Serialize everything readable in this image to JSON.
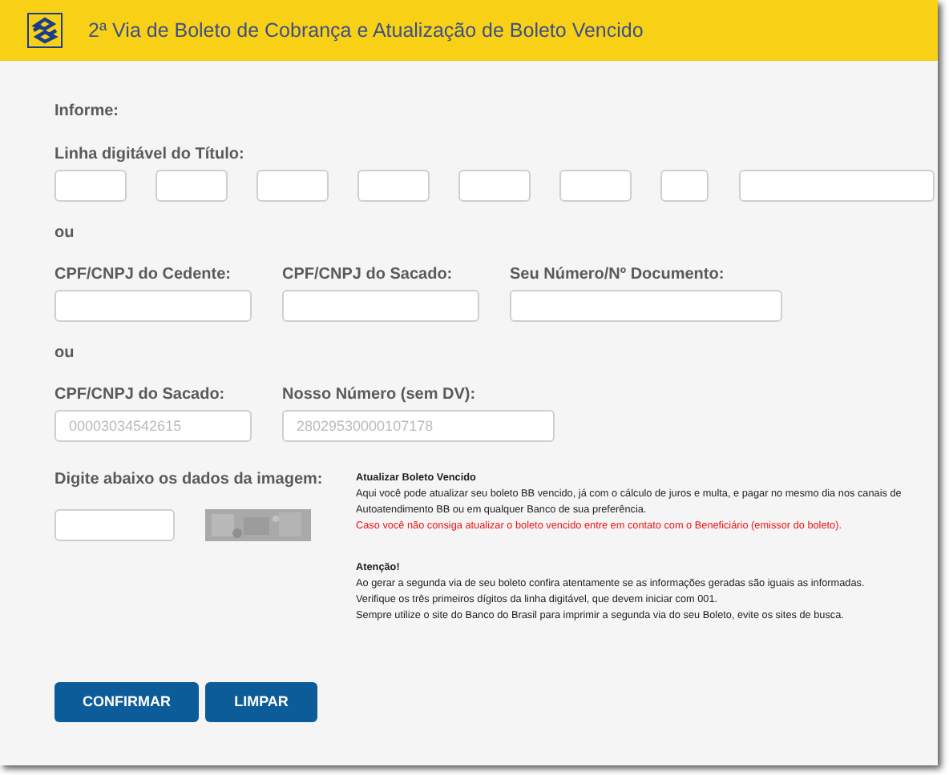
{
  "header": {
    "title": "2ª Via de Boleto de Cobrança e Atualização de Boleto Vencido"
  },
  "intro": "Informe:",
  "linha": {
    "label": "Linha digitável do Título:",
    "fields": [
      {
        "kind": "short"
      },
      {
        "kind": "short"
      },
      {
        "kind": "short"
      },
      {
        "kind": "short"
      },
      {
        "kind": "short"
      },
      {
        "kind": "short"
      },
      {
        "kind": "tiny"
      },
      {
        "kind": "long"
      }
    ]
  },
  "groups": [
    {
      "separator": "ou",
      "fields": [
        {
          "label": "CPF/CNPJ do Cedente:",
          "kind": "medium"
        },
        {
          "label": "CPF/CNPJ do Sacado:",
          "kind": "medium"
        },
        {
          "label": "Seu Número/Nº Documento:",
          "kind": "large"
        }
      ]
    },
    {
      "separator": "ou",
      "fields": [
        {
          "label": "CPF/CNPJ do Sacado:",
          "kind": "medium",
          "placeholder": "00003034542615"
        },
        {
          "label": "Nosso Número (sem DV):",
          "kind": "large",
          "placeholder": "28029530000107178"
        }
      ]
    }
  ],
  "captcha": {
    "label": "Digite abaixo os dados da imagem:"
  },
  "notes": [
    {
      "title": "Atualizar Boleto Vencido",
      "lines": [
        {
          "text": "Aqui você pode atualizar seu boleto BB vencido, já com o cálculo de juros e multa, e pagar no mesmo dia nos canais de Autoatendimento BB ou em qualquer Banco de sua preferência.",
          "kind": "normal"
        },
        {
          "text": "Caso você não consiga atualizar o boleto vencido entre em contato com o Beneficiário (emissor do boleto).",
          "kind": "warning"
        }
      ]
    },
    {
      "title": "Atenção!",
      "lines": [
        {
          "text": "Ao gerar a segunda via de seu boleto confira atentamente se as informações geradas são iguais as informadas.",
          "kind": "normal"
        },
        {
          "text": "Verifique os três primeiros dígitos da linha digitável, que devem iniciar com 001.",
          "kind": "normal"
        },
        {
          "text": "Sempre utilize o site do Banco do Brasil para imprimir a segunda via do seu Boleto, evite os sites de busca.",
          "kind": "normal"
        }
      ]
    }
  ],
  "buttons": [
    "CONFIRMAR",
    "LIMPAR"
  ]
}
